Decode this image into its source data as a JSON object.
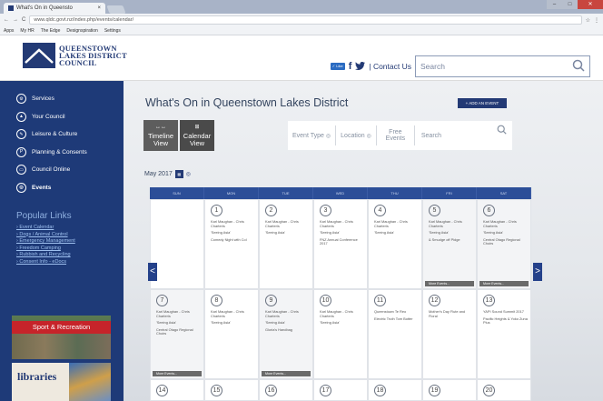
{
  "browser": {
    "tab_title": "What's On in Queensto",
    "tab_close": "×",
    "url": "www.qldc.govt.nz/index.php/events/calendar/",
    "nav_back": "←",
    "nav_forward": "→",
    "reload": "C",
    "star": "☆",
    "menu": "⋮",
    "bookmarks": [
      "Apps",
      "My HR",
      "The Edge",
      "Designspiration",
      "Settings"
    ]
  },
  "header": {
    "logo_lines": [
      "QUEENSTOWN",
      "LAKES DISTRICT",
      "COUNCIL"
    ],
    "flag_label": "✓ Like",
    "facebook": "f",
    "contact": "| Contact Us",
    "search_placeholder": "Search"
  },
  "sidebar": {
    "nav": [
      {
        "label": "Services",
        "icon": "services-icon",
        "glyph": "⚙"
      },
      {
        "label": "Your Council",
        "icon": "council-icon",
        "glyph": "▲"
      },
      {
        "label": "Leisure & Culture",
        "icon": "leisure-icon",
        "glyph": "✎"
      },
      {
        "label": "Planning & Consents",
        "icon": "planning-icon",
        "glyph": "P"
      },
      {
        "label": "Council Online",
        "icon": "online-icon",
        "glyph": "▭"
      },
      {
        "label": "Events",
        "icon": "events-icon",
        "glyph": "◎"
      }
    ],
    "popular_title": "Popular Links",
    "popular_links": [
      "› Event Calendar",
      "› Dogs / Animal Control",
      "› Emergency Management",
      "› Freedom Camping",
      "› Rubbish and Recycling",
      "› Consent Info - eDocs"
    ],
    "banner_sport": "Sport & Recreation",
    "banner_libraries": "libraries"
  },
  "main": {
    "title": "What's On in Queenstown Lakes District",
    "add_event": "+ ADD AN EVENT",
    "views": [
      {
        "label1": "Timeline",
        "label2": "View",
        "glyph": "↔↔"
      },
      {
        "label1": "Calendar",
        "label2": "View",
        "glyph": "⊞"
      }
    ],
    "filters": {
      "event_type": "Event Type",
      "location": "Location",
      "free": "Free Events",
      "search": "Search"
    },
    "month": "May 2017",
    "weekdays": [
      "SUN",
      "MON",
      "TUE",
      "WED",
      "THU",
      "FRI",
      "SAT"
    ],
    "weeks": [
      [
        {
          "num": "",
          "events": [],
          "more": ""
        },
        {
          "num": "1",
          "events": [
            "Karl Maughan - Chris Charteris",
            "'Seeing Asia'",
            "Comedy Night with Col"
          ],
          "more": ""
        },
        {
          "num": "2",
          "events": [
            "Karl Maughan - Chris Charteris",
            "'Seeing Asia'"
          ],
          "more": ""
        },
        {
          "num": "3",
          "events": [
            "Karl Maughan - Chris Charteris",
            "'Seeing Asia'",
            "FNZ Annual Conference 2017"
          ],
          "more": ""
        },
        {
          "num": "4",
          "events": [
            "Karl Maughan - Chris Charteris",
            "'Seeing Asia'"
          ],
          "more": ""
        },
        {
          "num": "5",
          "events": [
            "Karl Maughan - Chris Charteris",
            "'Seeing Asia'",
            "& Smudge off Pidge"
          ],
          "more": "More Events..."
        },
        {
          "num": "6",
          "events": [
            "Karl Maughan - Chris Charteris",
            "'Seeing Asia'",
            "Central Otago Regional Choirs"
          ],
          "more": "More Events..."
        }
      ],
      [
        {
          "num": "7",
          "events": [
            "Karl Maughan - Chris Charteris",
            "'Seeing Asia'",
            "Central Otago Regional Choirs"
          ],
          "more": "More Events..."
        },
        {
          "num": "8",
          "events": [
            "Karl Maughan - Chris Charteris",
            "'Seeing Asia'"
          ],
          "more": ""
        },
        {
          "num": "9",
          "events": [
            "Karl Maughan - Chris Charteris",
            "'Seeing Asia'",
            "Gloria's Handbag"
          ],
          "more": "More Events..."
        },
        {
          "num": "10",
          "events": [
            "Karl Maughan - Chris Charteris",
            "'Seeing Asia'"
          ],
          "more": ""
        },
        {
          "num": "11",
          "events": [
            "Queenstown Te Reo",
            "Electric Truth Tom Botter"
          ],
          "more": ""
        },
        {
          "num": "12",
          "events": [
            "Mother's Day Flute and Floral"
          ],
          "more": ""
        },
        {
          "num": "13",
          "events": [
            "YAPI Sound Summit 2017",
            "Pacific Heights & Yoko Zuna Plus"
          ],
          "more": ""
        }
      ],
      [
        {
          "num": "14"
        },
        {
          "num": "15"
        },
        {
          "num": "16"
        },
        {
          "num": "17"
        },
        {
          "num": "18"
        },
        {
          "num": "19"
        },
        {
          "num": "20"
        }
      ]
    ],
    "prev_arrow": "<",
    "next_arrow": ">"
  }
}
